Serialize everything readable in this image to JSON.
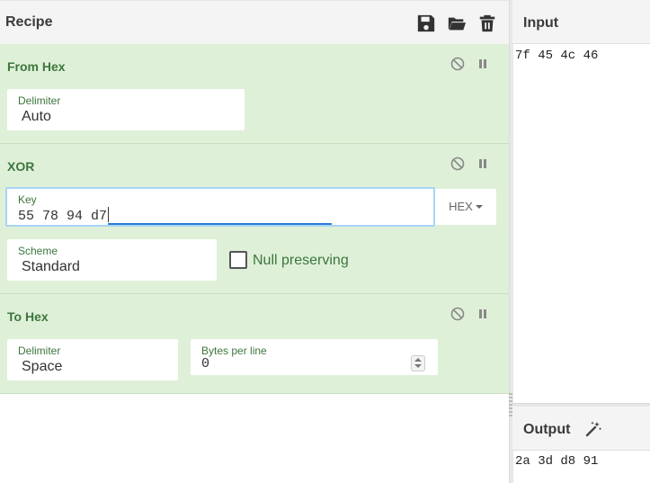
{
  "recipe": {
    "title": "Recipe",
    "icons": [
      "save-icon",
      "folder-open-icon",
      "trash-icon"
    ],
    "operations": [
      {
        "name": "From Hex",
        "controls": [
          "disable-icon",
          "pause-icon"
        ],
        "delimiter": {
          "label": "Delimiter",
          "value": "Auto"
        }
      },
      {
        "name": "XOR",
        "controls": [
          "disable-icon",
          "pause-icon"
        ],
        "key": {
          "label": "Key",
          "value": "55 78 94 d7",
          "format": "HEX"
        },
        "scheme": {
          "label": "Scheme",
          "value": "Standard"
        },
        "null_preserving": {
          "label": "Null preserving",
          "checked": false
        }
      },
      {
        "name": "To Hex",
        "controls": [
          "disable-icon",
          "pause-icon"
        ],
        "delimiter": {
          "label": "Delimiter",
          "value": "Space"
        },
        "bytes_per_line": {
          "label": "Bytes per line",
          "value": "0"
        }
      }
    ]
  },
  "input": {
    "title": "Input",
    "text": "7f 45 4c 46"
  },
  "output": {
    "title": "Output",
    "text": "2a 3d d8 91",
    "icon": "magic-wand-icon"
  },
  "colors": {
    "op_bg": "#dff0d8",
    "op_text": "#3c763d",
    "focus": "#2a7dd7"
  }
}
